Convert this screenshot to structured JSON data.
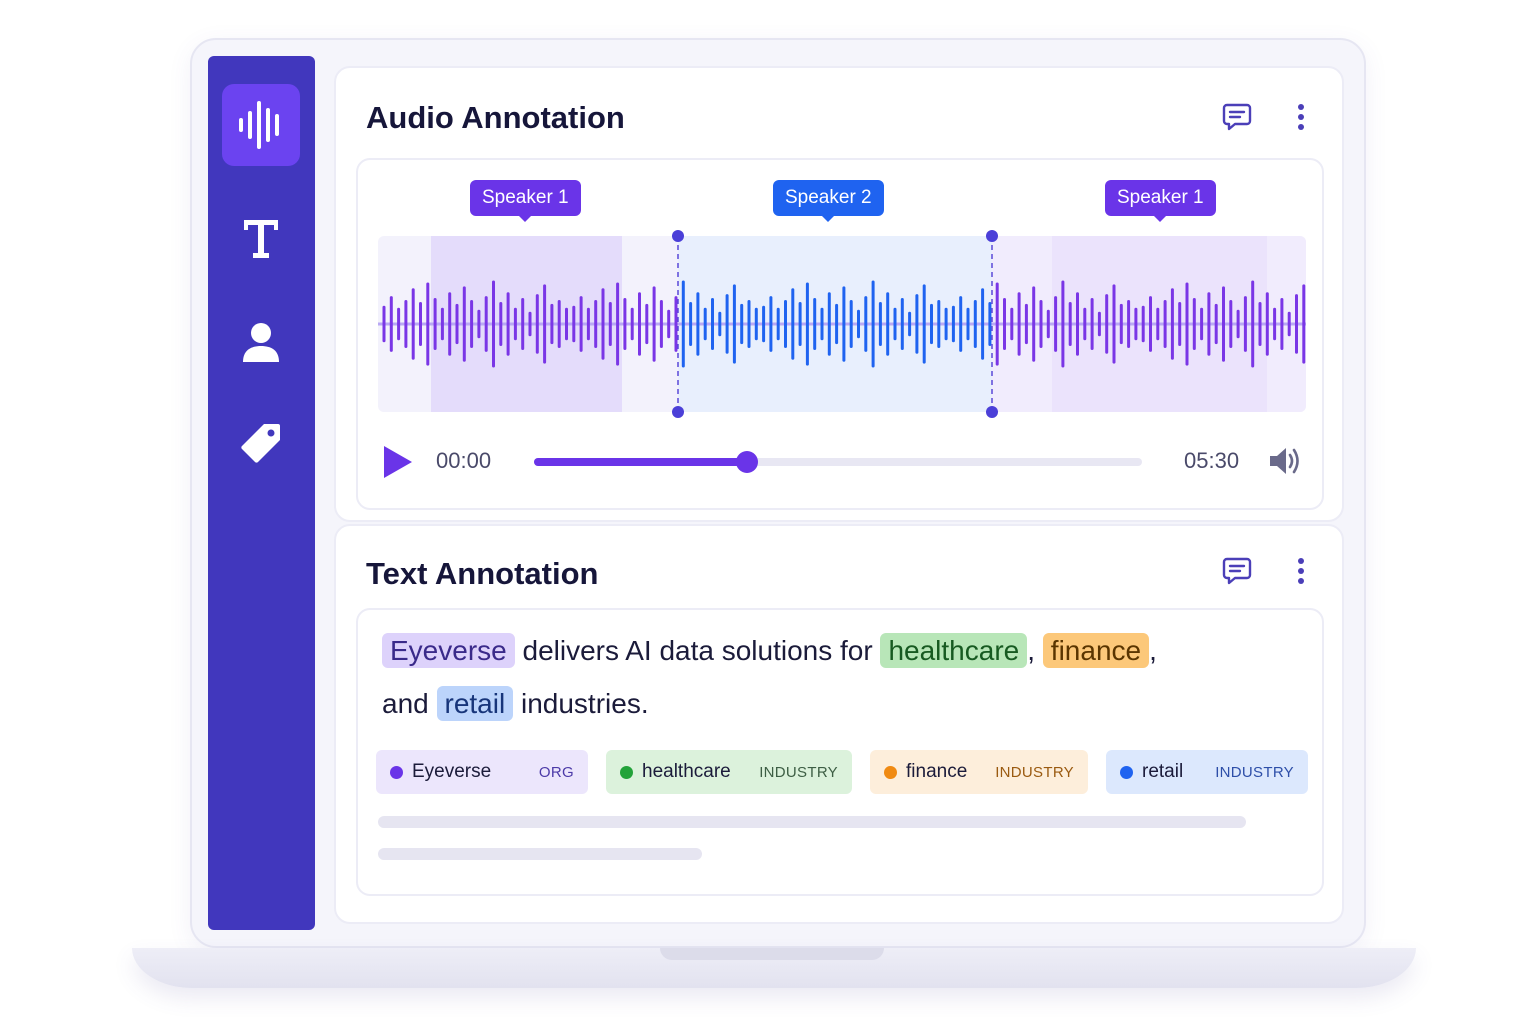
{
  "sidebar": {
    "items": [
      {
        "icon": "waveform-icon",
        "active": true
      },
      {
        "icon": "text-icon",
        "active": false
      },
      {
        "icon": "user-icon",
        "active": false
      },
      {
        "icon": "tag-icon",
        "active": false
      }
    ]
  },
  "audio": {
    "title": "Audio Annotation",
    "speakers": [
      {
        "label": "Speaker 1",
        "color": "#6a34e8"
      },
      {
        "label": "Speaker 2",
        "color": "#1f63f0"
      },
      {
        "label": "Speaker 1",
        "color": "#6a34e8"
      }
    ],
    "player": {
      "current_time": "00:00",
      "total_time": "05:30",
      "progress": 0.35
    }
  },
  "text": {
    "title": "Text Annotation",
    "sentence": {
      "entity_org": "Eyeverse",
      "part1": " delivers AI data solutions for ",
      "entity_health": "healthcare",
      "sep1": ", ",
      "entity_fin": "finance",
      "sep2": ",",
      "part2": "and ",
      "entity_retail": "retail",
      "part3": " industries."
    },
    "entities": [
      {
        "name": "Eyeverse",
        "type": "ORG",
        "color": "#6a34e8"
      },
      {
        "name": "healthcare",
        "type": "INDUSTRY",
        "color": "#23a33a"
      },
      {
        "name": "finance",
        "type": "INDUSTRY",
        "color": "#f08a12"
      },
      {
        "name": "retail",
        "type": "INDUSTRY",
        "color": "#1f63f0"
      }
    ]
  },
  "colors": {
    "sidebar": "#4137bd",
    "accent_purple": "#6a34e8",
    "accent_blue": "#1f63f0"
  }
}
